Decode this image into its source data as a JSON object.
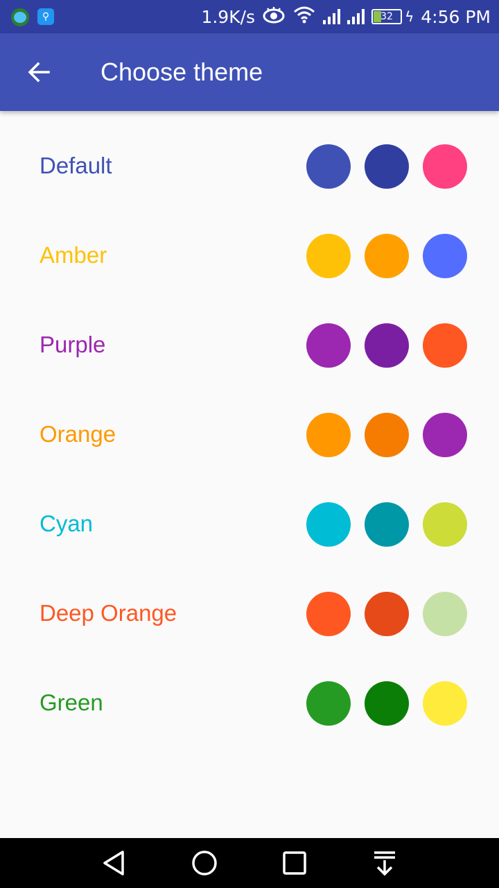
{
  "status_bar": {
    "speed": "1.9K/s",
    "battery": "32",
    "time": "4:56 PM"
  },
  "app_bar": {
    "title": "Choose theme",
    "back_icon": "arrow-back-icon"
  },
  "themes": [
    {
      "name": "Default",
      "color": "#3f51b5",
      "swatches": [
        "#3f51b5",
        "#303f9f",
        "#ff4081"
      ]
    },
    {
      "name": "Amber",
      "color": "#ffc107",
      "swatches": [
        "#ffc107",
        "#ffa000",
        "#536dfe"
      ]
    },
    {
      "name": "Purple",
      "color": "#9c27b0",
      "swatches": [
        "#9c27b0",
        "#7b1fa2",
        "#ff5722"
      ]
    },
    {
      "name": "Orange",
      "color": "#ff9800",
      "swatches": [
        "#ff9800",
        "#f57c00",
        "#9c27b0"
      ]
    },
    {
      "name": "Cyan",
      "color": "#00bcd4",
      "swatches": [
        "#00bcd4",
        "#0097a7",
        "#cddc39"
      ]
    },
    {
      "name": "Deep Orange",
      "color": "#ff5722",
      "swatches": [
        "#ff5722",
        "#e64a19",
        "#c5e1a5"
      ]
    },
    {
      "name": "Green",
      "color": "#259b24",
      "swatches": [
        "#259b24",
        "#0a7e07",
        "#ffeb3b"
      ]
    }
  ],
  "nav_bar": {
    "buttons": [
      "back-triangle-icon",
      "home-circle-icon",
      "recents-square-icon",
      "notification-pull-down-icon"
    ]
  }
}
